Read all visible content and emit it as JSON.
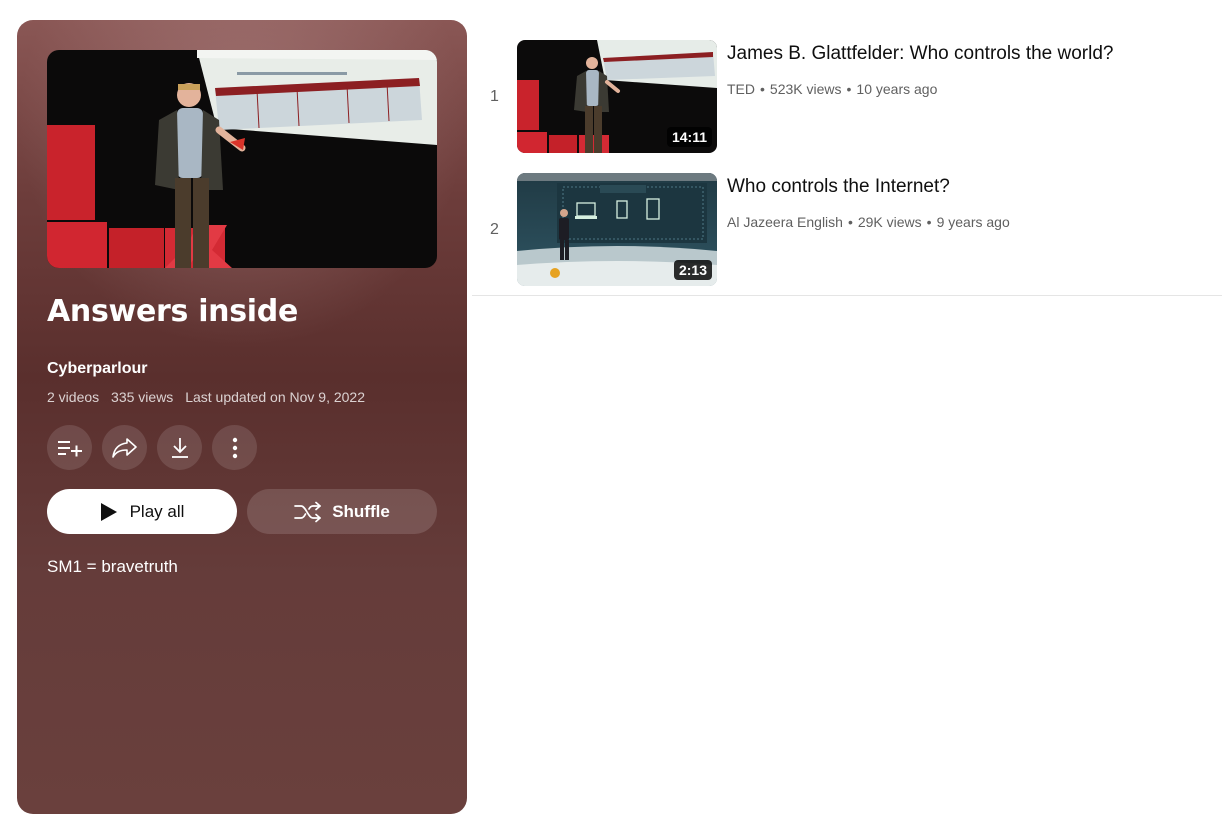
{
  "playlist": {
    "title": "Answers inside",
    "owner": "Cyberparlour",
    "video_count": "2 videos",
    "views": "335 views",
    "last_updated": "Last updated on Nov 9, 2022",
    "description": "SM1 = bravetruth",
    "play_all_label": "Play all",
    "shuffle_label": "Shuffle",
    "actions": [
      "add-to-queue-icon",
      "share-icon",
      "download-icon",
      "more-vert-icon"
    ]
  },
  "videos": [
    {
      "index": "1",
      "title": "James B. Glattfelder: Who controls the world?",
      "channel": "TED",
      "views": "523K views",
      "age": "10 years ago",
      "duration": "14:11"
    },
    {
      "index": "2",
      "title": "Who controls the Internet?",
      "channel": "Al Jazeera English",
      "views": "29K views",
      "age": "9 years ago",
      "duration": "2:13"
    }
  ],
  "colors": {
    "panel": "#6d3d3b",
    "ted_red": "#e62b1e"
  }
}
